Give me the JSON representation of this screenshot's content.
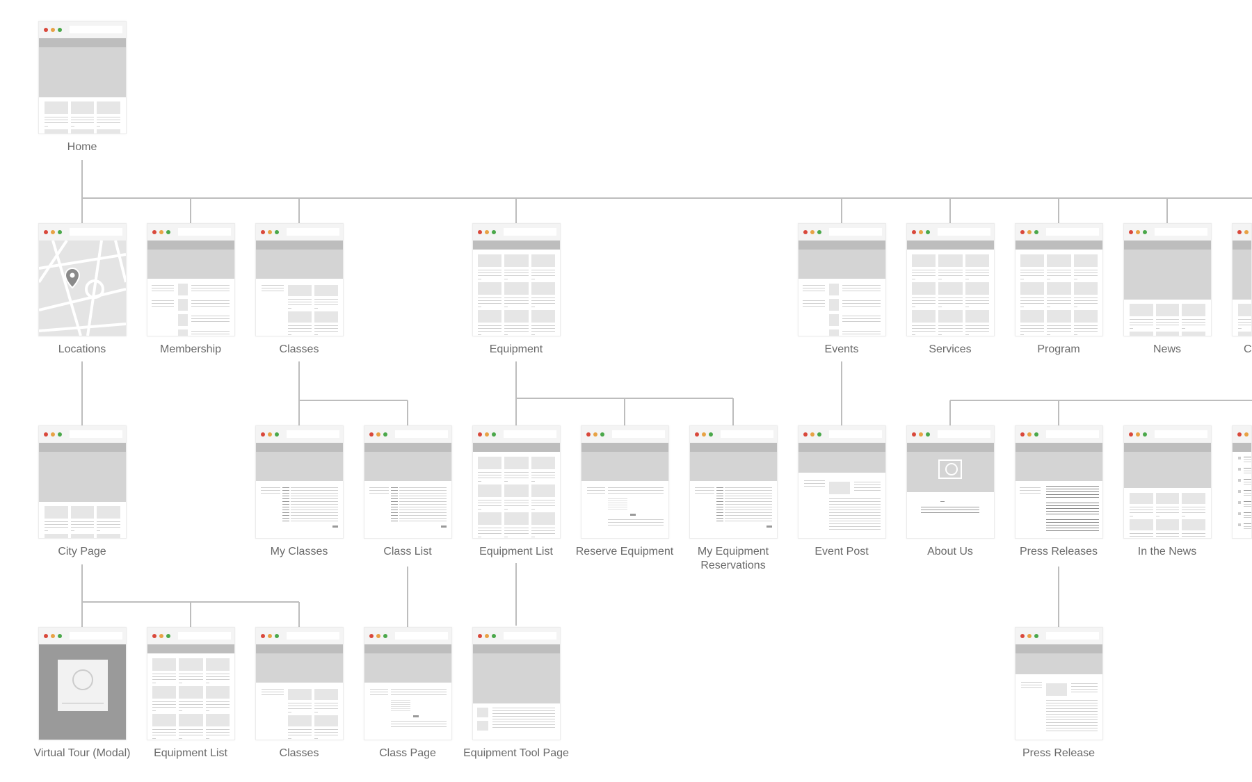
{
  "colors": {
    "connector": "#bdbdbd",
    "dot_red": "#d9483b",
    "dot_orange": "#e8a245",
    "dot_green": "#4aa84a",
    "nav": "#bdbdbd",
    "hero": "#d4d4d4",
    "block": "#e6e6e6",
    "text_line": "#cfcfcf"
  },
  "nodes": [
    {
      "id": "home",
      "label": "Home",
      "thumbnail": "hero-grid"
    },
    {
      "id": "locations",
      "label": "Locations",
      "thumbnail": "map"
    },
    {
      "id": "membership",
      "label": "Membership",
      "thumbnail": "hero-sidebar-list"
    },
    {
      "id": "classes",
      "label": "Classes",
      "thumbnail": "hero-sidebar-grid"
    },
    {
      "id": "equipment",
      "label": "Equipment",
      "thumbnail": "grid"
    },
    {
      "id": "events",
      "label": "Events",
      "thumbnail": "hero-sidebar-list"
    },
    {
      "id": "services",
      "label": "Services",
      "thumbnail": "grid"
    },
    {
      "id": "program",
      "label": "Program",
      "thumbnail": "grid"
    },
    {
      "id": "news",
      "label": "News",
      "thumbnail": "hero-grid"
    },
    {
      "id": "cutoff-top",
      "label": "C",
      "thumbnail": "hero-grid"
    },
    {
      "id": "city-page",
      "label": "City Page",
      "thumbnail": "hero-grid"
    },
    {
      "id": "my-classes",
      "label": "My Classes",
      "thumbnail": "hero-table"
    },
    {
      "id": "class-list",
      "label": "Class List",
      "thumbnail": "hero-table"
    },
    {
      "id": "equipment-list",
      "label": "Equipment List",
      "thumbnail": "grid"
    },
    {
      "id": "reserve-equipment",
      "label": "Reserve Equipment",
      "thumbnail": "hero-form"
    },
    {
      "id": "my-equipment-reservations",
      "label": "My Equipment Reservations",
      "thumbnail": "hero-table"
    },
    {
      "id": "event-post",
      "label": "Event Post",
      "thumbnail": "doc"
    },
    {
      "id": "about-us",
      "label": "About Us",
      "thumbnail": "video"
    },
    {
      "id": "press-releases",
      "label": "Press Releases",
      "thumbnail": "hero-text"
    },
    {
      "id": "in-the-news",
      "label": "In the News",
      "thumbnail": "hero-grid2"
    },
    {
      "id": "cutoff-mid",
      "label": "",
      "thumbnail": "list"
    },
    {
      "id": "virtual-tour",
      "label": "Virtual Tour (Modal)",
      "thumbnail": "modal"
    },
    {
      "id": "city-equipment-list",
      "label": "Equipment List",
      "thumbnail": "grid"
    },
    {
      "id": "city-classes",
      "label": "Classes",
      "thumbnail": "hero-sidebar-grid"
    },
    {
      "id": "class-page",
      "label": "Class Page",
      "thumbnail": "hero-form"
    },
    {
      "id": "equipment-tool-page",
      "label": "Equipment Tool Page",
      "thumbnail": "tool"
    },
    {
      "id": "press-release",
      "label": "Press Release",
      "thumbnail": "doc"
    }
  ]
}
